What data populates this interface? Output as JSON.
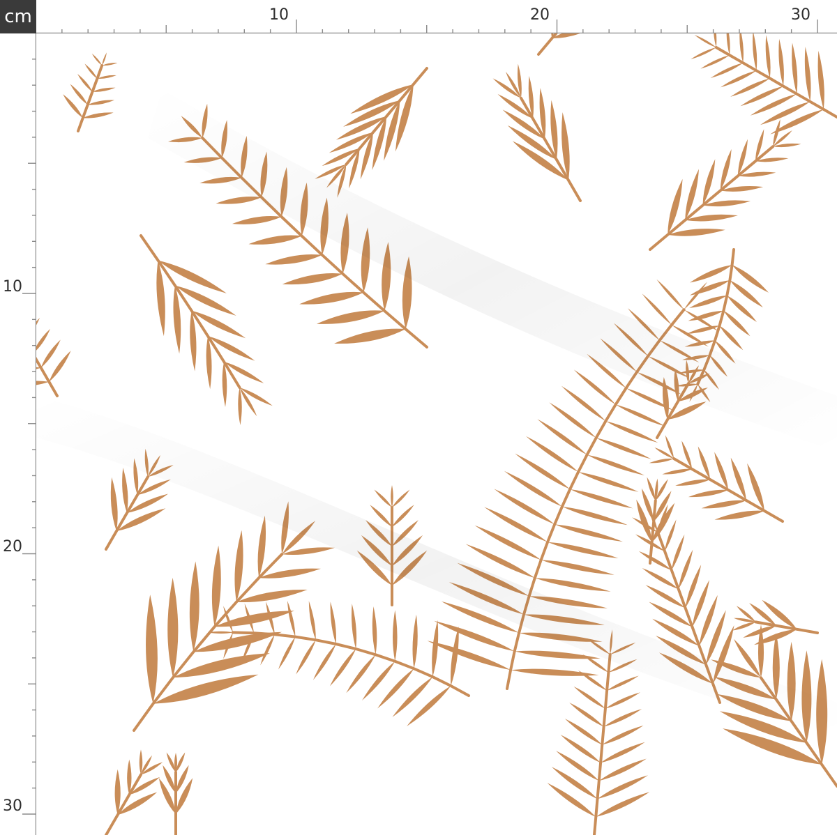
{
  "ruler": {
    "unit": "cm",
    "top_labels": [
      "10",
      "20",
      "30"
    ],
    "left_labels": [
      "10",
      "20",
      "30"
    ]
  },
  "fabric": {
    "background_color": "#ffffff",
    "leaf_color": "#c98d58",
    "leaf_highlight": "#d9a36c",
    "shadow_color": "#e4e4e4",
    "pattern_icon": "fern-leaf-pattern"
  }
}
